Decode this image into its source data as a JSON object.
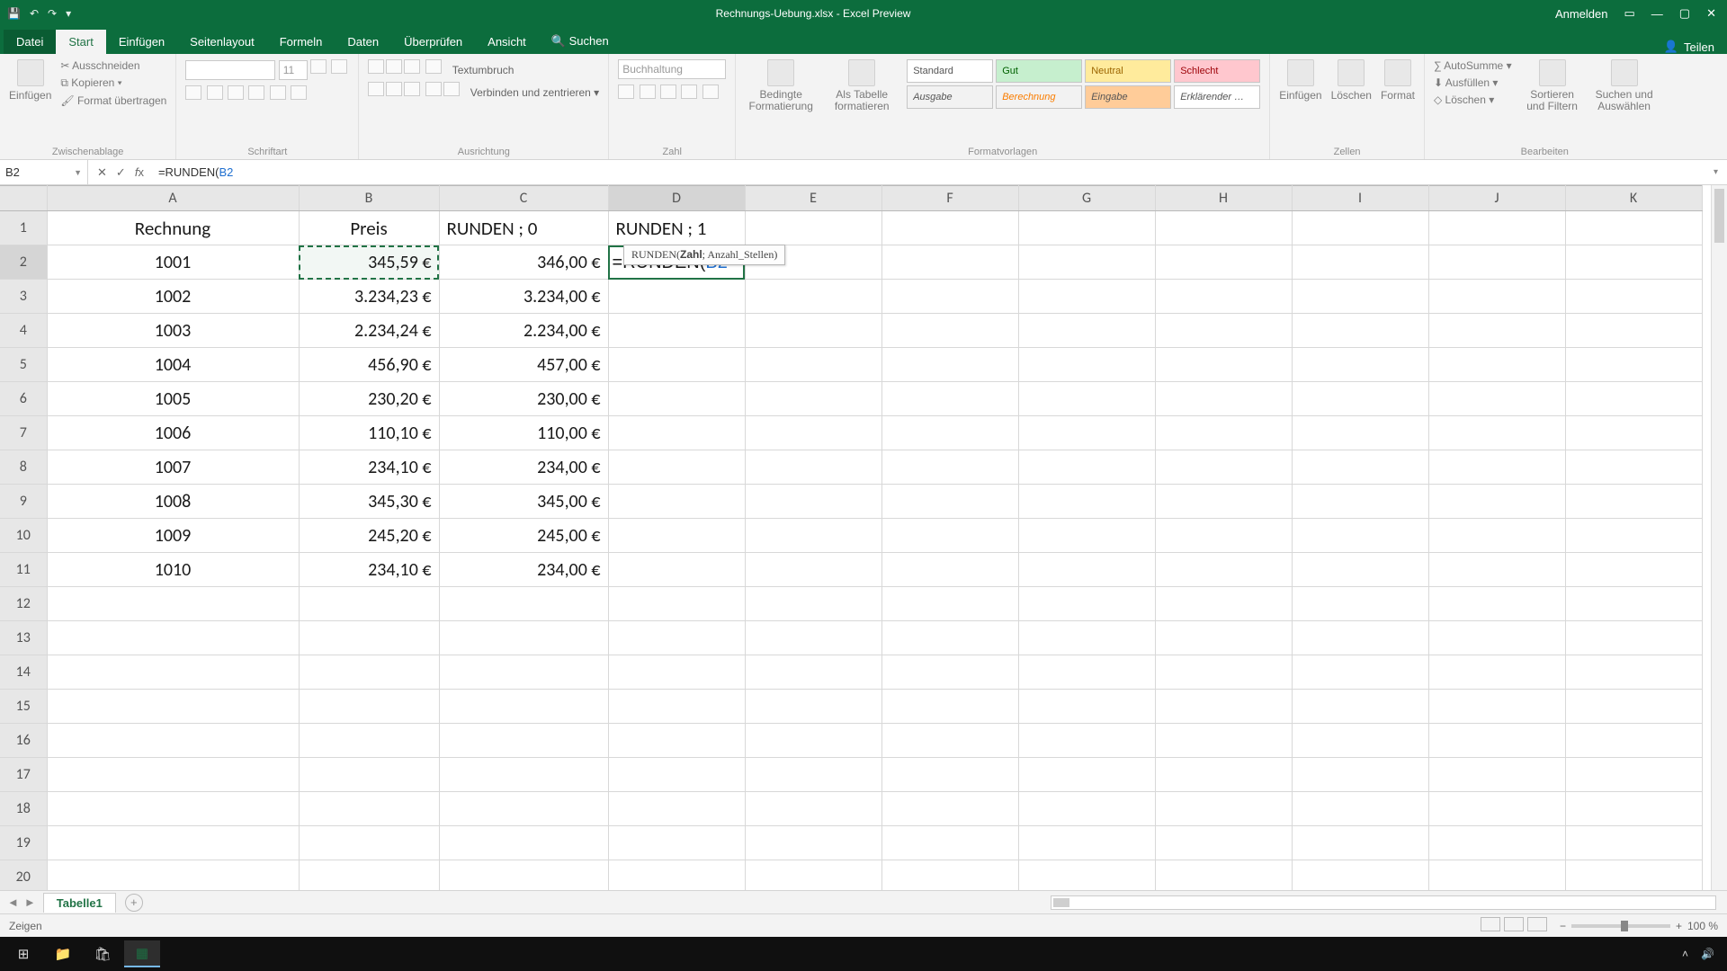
{
  "titlebar": {
    "title": "Rechnungs-Uebung.xlsx - Excel Preview",
    "signin": "Anmelden"
  },
  "ribbon": {
    "tabs": [
      "Datei",
      "Start",
      "Einfügen",
      "Seitenlayout",
      "Formeln",
      "Daten",
      "Überprüfen",
      "Ansicht"
    ],
    "active_tab": "Start",
    "tellme": "Suchen",
    "share": "Teilen",
    "clipboard": {
      "paste": "Einfügen",
      "cut": "Ausschneiden",
      "copy": "Kopieren",
      "painter": "Format übertragen",
      "label": "Zwischenablage"
    },
    "font": {
      "name": "",
      "size": "11",
      "label": "Schriftart"
    },
    "alignment": {
      "wrap": "Textumbruch",
      "merge": "Verbinden und zentrieren",
      "label": "Ausrichtung"
    },
    "number": {
      "format": "Buchhaltung",
      "label": "Zahl"
    },
    "styles": {
      "cond": "Bedingte Formatierung",
      "table": "Als Tabelle formatieren",
      "gallery": [
        "Standard",
        "Gut",
        "Neutral",
        "Schlecht",
        "Ausgabe",
        "Berechnung",
        "Eingabe",
        "Erklärender …"
      ],
      "label": "Formatvorlagen"
    },
    "cells": {
      "insert": "Einfügen",
      "delete": "Löschen",
      "format": "Format",
      "label": "Zellen"
    },
    "editing": {
      "autosum": "AutoSumme",
      "fill": "Ausfüllen",
      "clear": "Löschen",
      "sort": "Sortieren und Filtern",
      "find": "Suchen und Auswählen",
      "label": "Bearbeiten"
    }
  },
  "formula_bar": {
    "namebox": "B2",
    "formula_prefix": "=RUNDEN(",
    "formula_ref": "B2"
  },
  "columns": [
    "A",
    "B",
    "C",
    "D",
    "E",
    "F",
    "G",
    "H",
    "I",
    "J",
    "K"
  ],
  "row_count": 20,
  "headers": {
    "A": "Rechnung",
    "B": "Preis",
    "C": "RUNDEN ; 0",
    "D": "RUNDEN ; 1"
  },
  "data_rows": [
    {
      "A": "1001",
      "B": "345,59 €",
      "C": "346,00 €"
    },
    {
      "A": "1002",
      "B": "3.234,23 €",
      "C": "3.234,00 €"
    },
    {
      "A": "1003",
      "B": "2.234,24 €",
      "C": "2.234,00 €"
    },
    {
      "A": "1004",
      "B": "456,90 €",
      "C": "457,00 €"
    },
    {
      "A": "1005",
      "B": "230,20 €",
      "C": "230,00 €"
    },
    {
      "A": "1006",
      "B": "110,10 €",
      "C": "110,00 €"
    },
    {
      "A": "1007",
      "B": "234,10 €",
      "C": "234,00 €"
    },
    {
      "A": "1008",
      "B": "345,30 €",
      "C": "345,00 €"
    },
    {
      "A": "1009",
      "B": "245,20 €",
      "C": "245,00 €"
    },
    {
      "A": "1010",
      "B": "234,10 €",
      "C": "234,00 €"
    }
  ],
  "editing_cell": {
    "display_prefix": "=RUNDEN(",
    "display_ref": "B2",
    "tooltip": "RUNDEN(Zahl; Anzahl_Stellen)",
    "tooltip_bold": "Zahl"
  },
  "sheet_tabs": {
    "active": "Tabelle1"
  },
  "statusbar": {
    "mode": "Zeigen",
    "zoom": "100 %"
  }
}
